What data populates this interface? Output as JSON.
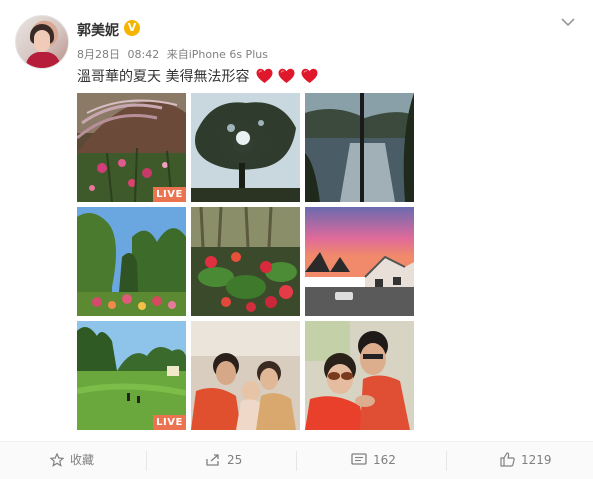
{
  "user": {
    "name": "郭美妮",
    "verified_badge": "V"
  },
  "meta": {
    "date": "8月28日",
    "time": "08:42",
    "source_prefix": "来自",
    "source": "iPhone 6s Plus"
  },
  "post": {
    "text": "溫哥華的夏天 美得無法形容",
    "heart_count": 3
  },
  "photos": [
    {
      "live": "LIVE"
    },
    {
      "live": ""
    },
    {
      "live": ""
    },
    {
      "live": ""
    },
    {
      "live": ""
    },
    {
      "live": ""
    },
    {
      "live": "LIVE"
    },
    {
      "live": ""
    },
    {
      "live": ""
    }
  ],
  "actions": {
    "favorite_label": "收藏",
    "repost_count": "25",
    "comment_count": "162",
    "like_count": "1219"
  },
  "colors": {
    "live_badge": "#eb7350",
    "verified": "#f5b400",
    "heart": "#e0182b"
  }
}
